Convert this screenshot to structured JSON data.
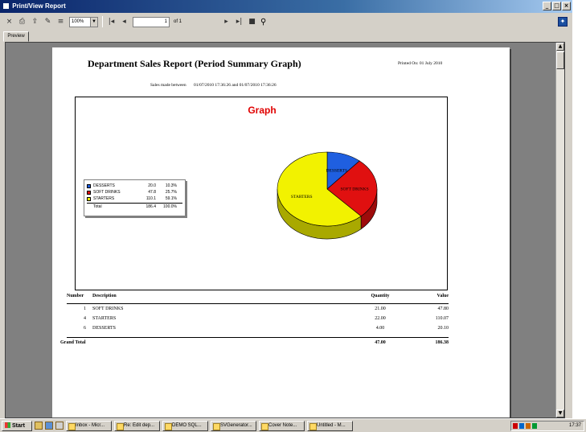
{
  "window": {
    "title": "Print/View Report",
    "controls": {
      "minimize": "_",
      "maximize": "□",
      "close": "×"
    }
  },
  "toolbar": {
    "zoom_value": "100%",
    "page_value": "1",
    "page_of": "of 1",
    "icons": [
      "close-icon",
      "print-icon",
      "export-icon",
      "print-setup-icon",
      "tree-toggle-icon",
      "first-page-icon",
      "prev-page-icon",
      "next-page-icon",
      "last-page-icon",
      "stop-icon",
      "search-icon"
    ]
  },
  "tabs": [
    {
      "label": "Preview"
    }
  ],
  "report": {
    "title": "Department Sales Report (Period Summary Graph)",
    "printed_on": "Printed On: 01 July 2010",
    "subtitle_label": "Sales made between",
    "subtitle_range": "01/07/2010  17:36:26  and  01/07/2010  17:36:26",
    "graph_title": "Graph",
    "legend": [
      {
        "name": "DESSERTS",
        "value": "20.0",
        "pct": "10.3%",
        "color": "#1f5fe0"
      },
      {
        "name": "SOFT DRINKS",
        "value": "47.8",
        "pct": "25.7%",
        "color": "#e01010"
      },
      {
        "name": "STARTERS",
        "value": "110.1",
        "pct": "59.1%",
        "color": "#f2f200"
      }
    ],
    "legend_total": {
      "label": "Total",
      "value": "186.4",
      "pct": "100.0%"
    },
    "pie_slices": [
      {
        "label": "DESSERTS",
        "value": 20.0,
        "color": "#1f5fe0"
      },
      {
        "label": "SOFT DRINKS",
        "value": 47.8,
        "color": "#e01010"
      },
      {
        "label": "STARTERS",
        "value": 110.1,
        "color": "#f2f200"
      }
    ],
    "table": {
      "headers": {
        "number": "Number",
        "description": "Description",
        "quantity": "Quantity",
        "value": "Value"
      },
      "rows": [
        {
          "number": "1",
          "description": "SOFT DRINKS",
          "quantity": "21.00",
          "value": "47.80"
        },
        {
          "number": "4",
          "description": "STARTERS",
          "quantity": "22.00",
          "value": "110.07"
        },
        {
          "number": "6",
          "description": "DESSERTS",
          "quantity": "4.00",
          "value": "20.10"
        }
      ],
      "grand_total": {
        "label": "Grand Total",
        "quantity": "47.00",
        "value": "186.38"
      }
    }
  },
  "taskbar": {
    "start_label": "Start",
    "tasks": [
      {
        "label": "Inbox - Micr..."
      },
      {
        "label": "Re: Edit dep..."
      },
      {
        "label": "DEMO SQL..."
      },
      {
        "label": "SVGenerator..."
      },
      {
        "label": "Cover Note..."
      },
      {
        "label": "Untitled - M..."
      }
    ],
    "clock": "17:37"
  }
}
